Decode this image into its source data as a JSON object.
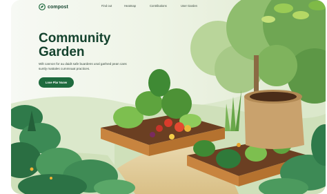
{
  "brand": {
    "name": "compost"
  },
  "nav": {
    "items": [
      {
        "label": "Find out"
      },
      {
        "label": "Heatmap"
      },
      {
        "label": "Contributions"
      },
      {
        "label": "User Garden"
      }
    ]
  },
  "hero": {
    "title_line1": "Community",
    "title_line2": "Garden",
    "body": "Wilt cannon for au daidt safe buardens unal garlned pean cans suntly mattales cummnaat practices.",
    "cta_label": "Lose Plar Nuow"
  },
  "colors": {
    "brand_green": "#1f6b3e",
    "title_green": "#14422d"
  }
}
